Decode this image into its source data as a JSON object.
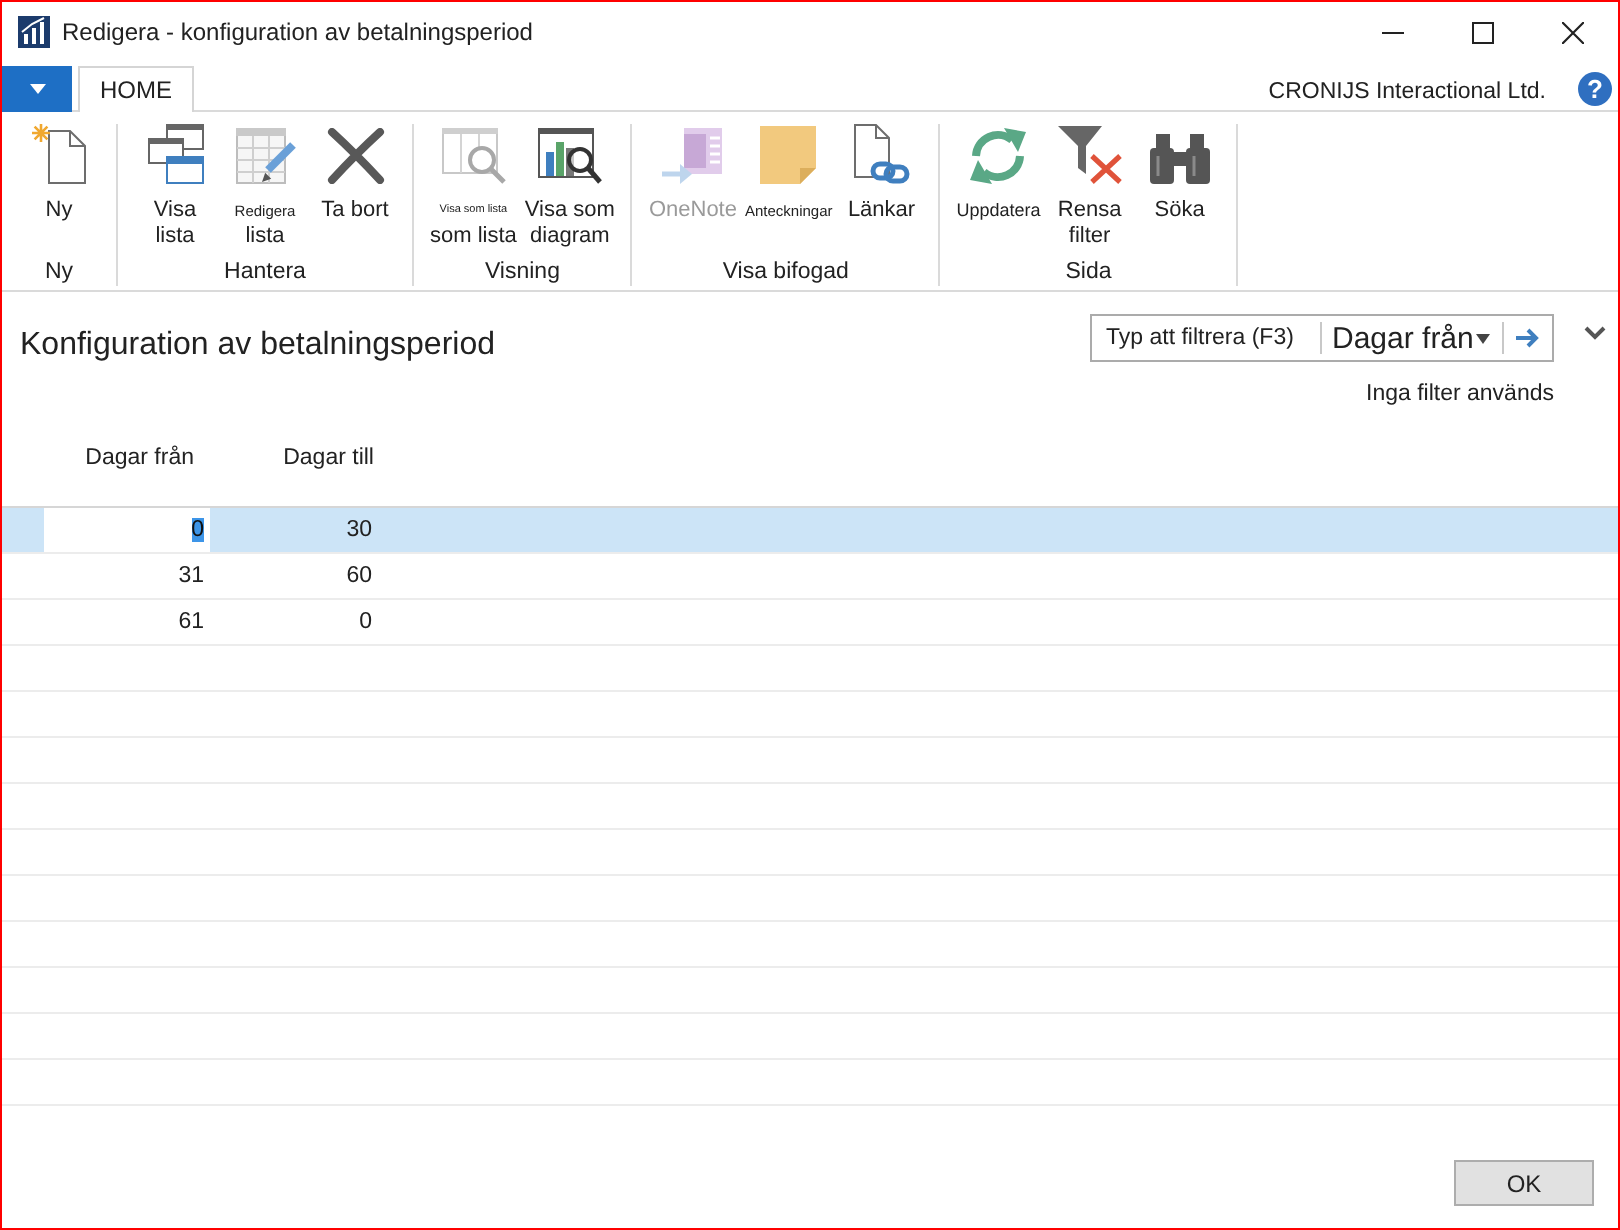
{
  "window": {
    "title": "Redigera - konfiguration av betalningsperiod"
  },
  "ribbon": {
    "tabs": [
      {
        "label": "HOME",
        "selected": true
      }
    ],
    "company": "CRONIJS Interactional Ltd.",
    "help": "?",
    "groups": [
      {
        "label": "Ny",
        "buttons": [
          {
            "kind": "new",
            "disabled": false,
            "lines": [
              {
                "text": "Ny",
                "kind": "normal"
              }
            ]
          }
        ]
      },
      {
        "label": "Hantera",
        "buttons": [
          {
            "kind": "viewlist",
            "disabled": false,
            "lines": [
              {
                "text": "Visa",
                "kind": "normal"
              },
              {
                "text": "lista",
                "kind": "normal"
              }
            ]
          },
          {
            "kind": "editlist",
            "disabled": false,
            "lines": [
              {
                "text": "Redigera",
                "kind": "small"
              },
              {
                "text": "lista",
                "kind": "normal"
              }
            ]
          },
          {
            "kind": "delete",
            "disabled": false,
            "lines": [
              {
                "text": "Ta bort",
                "kind": "normal"
              }
            ]
          }
        ]
      },
      {
        "label": "Visning",
        "buttons": [
          {
            "kind": "showlist",
            "disabled": false,
            "lines": [
              {
                "text": "Visa som lista",
                "kind": "tiny"
              },
              {
                "text": "som lista",
                "kind": "normal"
              }
            ]
          },
          {
            "kind": "chart",
            "disabled": false,
            "lines": [
              {
                "text": "Visa som",
                "kind": "normal"
              },
              {
                "text": "diagram",
                "kind": "normal"
              }
            ]
          }
        ]
      },
      {
        "label": "Visa bifogad",
        "buttons": [
          {
            "kind": "onenote",
            "disabled": true,
            "lines": [
              {
                "text": "OneNote",
                "kind": "normal"
              }
            ]
          },
          {
            "kind": "notes",
            "disabled": false,
            "lines": [
              {
                "text": "Anteckningar",
                "kind": "small"
              }
            ]
          },
          {
            "kind": "links",
            "disabled": false,
            "lines": [
              {
                "text": "Länkar",
                "kind": "normal"
              }
            ]
          }
        ]
      },
      {
        "label": "Sida",
        "buttons": [
          {
            "kind": "refresh",
            "disabled": false,
            "lines": [
              {
                "text": "Uppdatera",
                "kind": "medium"
              }
            ]
          },
          {
            "kind": "clearfilter",
            "disabled": false,
            "lines": [
              {
                "text": "Rensa",
                "kind": "normal"
              },
              {
                "text": "filter",
                "kind": "normal"
              }
            ]
          },
          {
            "kind": "find",
            "disabled": false,
            "lines": [
              {
                "text": "Söka",
                "kind": "normal"
              }
            ]
          }
        ]
      }
    ]
  },
  "page": {
    "title": "Konfiguration av betalningsperiod",
    "filter": {
      "placeholder": "Typ att filtrera (F3)",
      "field": "Dagar från"
    },
    "filter_status": "Inga filter används"
  },
  "table": {
    "columns": [
      "Dagar från",
      "Dagar till"
    ],
    "rows": [
      {
        "selected": true,
        "cells": [
          "0",
          "30"
        ]
      },
      {
        "selected": false,
        "cells": [
          "31",
          "60"
        ]
      },
      {
        "selected": false,
        "cells": [
          "61",
          "0"
        ]
      }
    ]
  },
  "buttons": [
    "OK"
  ]
}
